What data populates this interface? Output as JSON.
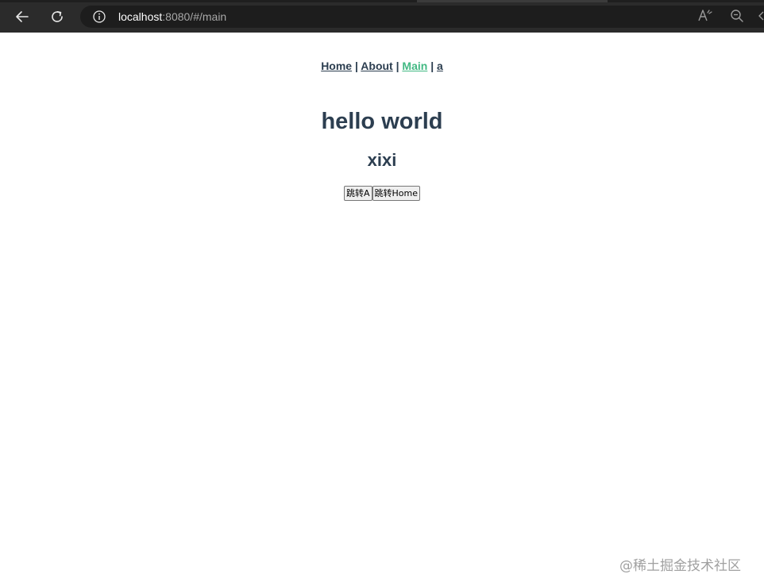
{
  "browser": {
    "url_host": "localhost",
    "url_rest": ":8080/#/main",
    "icons": {
      "back": "back-arrow-icon",
      "reload": "reload-icon",
      "info": "info-icon",
      "read_aloud": "read-aloud-icon",
      "zoom": "zoom-out-icon"
    }
  },
  "nav": {
    "links": [
      {
        "label": "Home"
      },
      {
        "label": "About"
      },
      {
        "label": "Main"
      },
      {
        "label": "a"
      }
    ],
    "separator": "|",
    "active_color": "#42b983",
    "text_color": "#2c3e50"
  },
  "content": {
    "title": "hello world",
    "subtitle": "xixi",
    "buttons": [
      {
        "label": "跳转A"
      },
      {
        "label": "跳转Home"
      }
    ]
  },
  "watermark": "@稀土掘金技术社区"
}
